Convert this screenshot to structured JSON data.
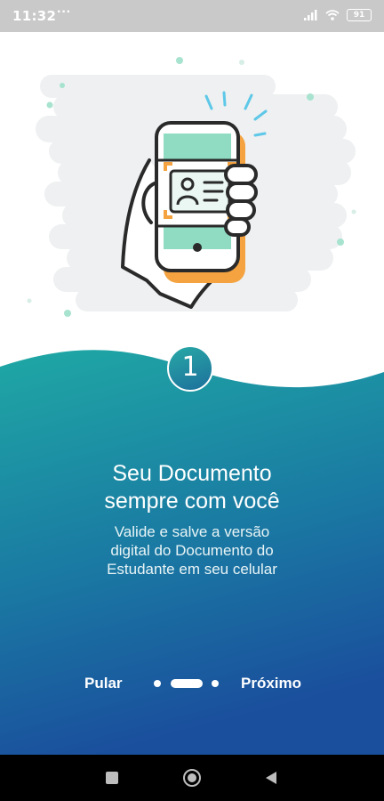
{
  "status_bar": {
    "time": "11:32",
    "overflow": "···",
    "battery": "91",
    "icons": [
      "signal-icon",
      "wifi-icon",
      "battery-icon"
    ]
  },
  "onboarding": {
    "step_number": "1",
    "title_line1": "Seu Documento",
    "title_line2": "sempre com você",
    "subtitle_line1": "Valide e salve a versão",
    "subtitle_line2": "digital do Documento do",
    "subtitle_line3": "Estudante em seu celular",
    "total_steps": 3,
    "current_step": 2
  },
  "nav": {
    "skip_label": "Pular",
    "next_label": "Próximo"
  },
  "system_nav": {
    "icons": [
      "recents-square-icon",
      "home-circle-icon",
      "back-triangle-icon"
    ]
  },
  "colors": {
    "teal": "#1fa8a4",
    "blue": "#1a4f9d",
    "mint": "#8fdcc2",
    "orange": "#f4a340",
    "cloud": "#eef0f1",
    "outline": "#2a2a2a"
  }
}
